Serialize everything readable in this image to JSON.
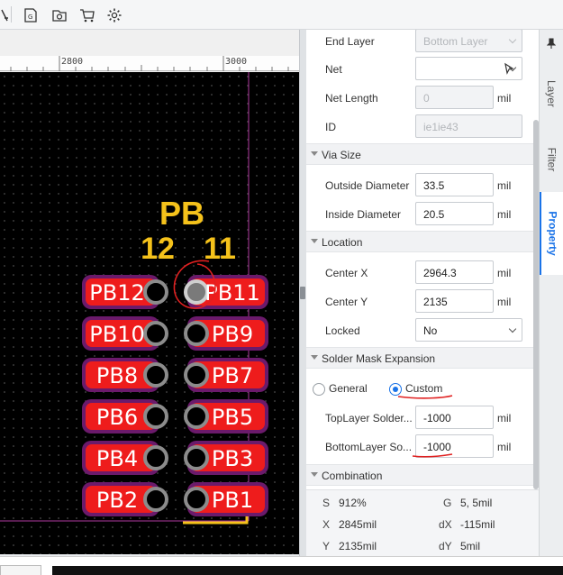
{
  "canvas": {
    "ruler_labels": [
      "2800",
      "3000"
    ],
    "silk_header": "PB",
    "silk_col_left": "12",
    "silk_col_right": "11",
    "pad_colors": {
      "pad_red": "#ee1c1c",
      "mask_purple": "#6b1a6b",
      "via_gray": "#8c8c8c",
      "silk_yellow": "#f5c21b"
    },
    "pad_rows": [
      {
        "left": "PB12",
        "right": "PB11",
        "right_via_selected": true
      },
      {
        "left": "PB10",
        "right": "PB9",
        "right_via_selected": false
      },
      {
        "left": "PB8",
        "right": "PB7",
        "right_via_selected": false
      },
      {
        "left": "PB6",
        "right": "PB5",
        "right_via_selected": false
      },
      {
        "left": "PB4",
        "right": "PB3",
        "right_via_selected": false
      },
      {
        "left": "PB2",
        "right": "PB1",
        "right_via_selected": false
      }
    ]
  },
  "panel": {
    "unit": "mil",
    "end_layer": {
      "label": "End Layer",
      "value": "Bottom Layer"
    },
    "net": {
      "label": "Net",
      "value": ""
    },
    "net_length": {
      "label": "Net Length",
      "value": "0"
    },
    "id": {
      "label": "ID",
      "value": "ie1ie43"
    },
    "sections": {
      "via_size": "Via Size",
      "location": "Location",
      "solder_mask": "Solder Mask Expansion",
      "combination": "Combination"
    },
    "outside_diameter": {
      "label": "Outside Diameter",
      "value": "33.5"
    },
    "inside_diameter": {
      "label": "Inside Diameter",
      "value": "20.5"
    },
    "center_x": {
      "label": "Center X",
      "value": "2964.3"
    },
    "center_y": {
      "label": "Center Y",
      "value": "2135"
    },
    "locked": {
      "label": "Locked",
      "value": "No"
    },
    "solder_mask_mode": {
      "general": "General",
      "custom": "Custom",
      "selected": "custom"
    },
    "top_solder": {
      "label": "TopLayer Solder...",
      "value": "-1000"
    },
    "bottom_solder": {
      "label": "BottomLayer So...",
      "value": "-1000"
    }
  },
  "status": {
    "s": {
      "key": "S",
      "value": "912%"
    },
    "g": {
      "key": "G",
      "value": "5, 5mil"
    },
    "x": {
      "key": "X",
      "value": "2845mil"
    },
    "dx": {
      "key": "dX",
      "value": "-115mil"
    },
    "y": {
      "key": "Y",
      "value": "2135mil"
    },
    "dy": {
      "key": "dY",
      "value": "5mil"
    }
  },
  "side_tabs": [
    "Layer",
    "Filter",
    "Property"
  ],
  "accent_color": "#1a73e8"
}
